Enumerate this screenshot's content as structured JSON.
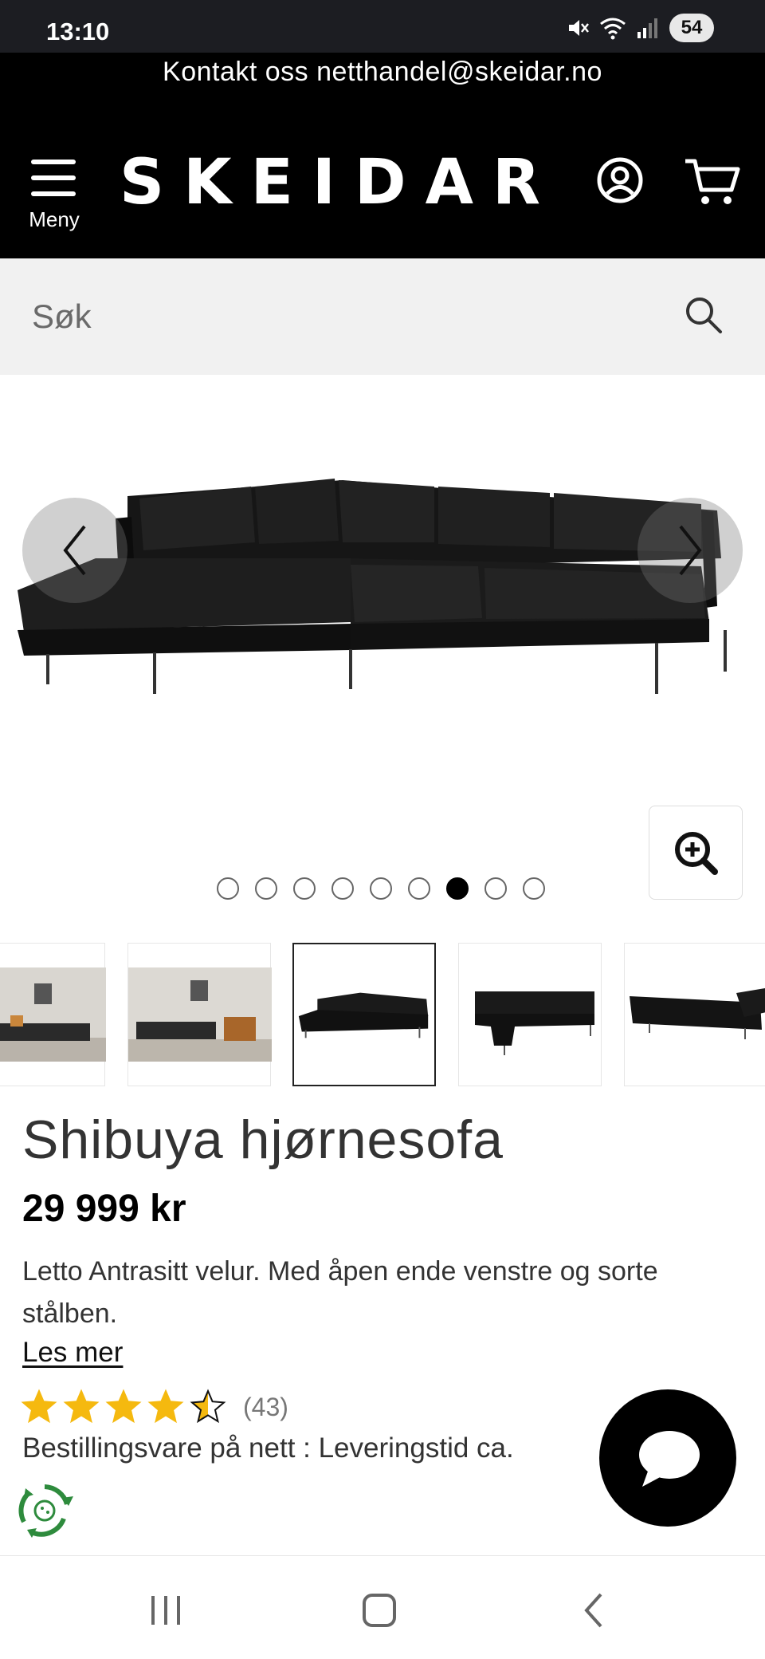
{
  "status_bar": {
    "time": "13:10",
    "battery": "54"
  },
  "header": {
    "contact_text": "Kontakt oss netthandel@skeidar.no",
    "menu_label": "Meny",
    "logo_text": "SKEIDAR"
  },
  "search": {
    "placeholder": "Søk"
  },
  "gallery": {
    "dot_count": 9,
    "active_index": 6
  },
  "product": {
    "title": "Shibuya hjørnesofa",
    "price": "29 999 kr",
    "description": "Letto Antrasitt velur. Med åpen ende venstre og sorte stålben.",
    "read_more": "Les mer",
    "rating_value": 4.5,
    "rating_count": "(43)",
    "delivery": "Bestillingsvare på nett : Leveringstid ca."
  },
  "colors": {
    "header_bg": "#000000",
    "search_bg": "#f1f1f1",
    "star": "#f5b90f",
    "eco_green": "#2e8b3d"
  },
  "icons": [
    "hamburger-icon",
    "account-icon",
    "cart-icon",
    "search-icon",
    "chevron-left-icon",
    "chevron-right-icon",
    "zoom-in-icon",
    "star-icon",
    "recycle-icon",
    "chat-icon"
  ]
}
